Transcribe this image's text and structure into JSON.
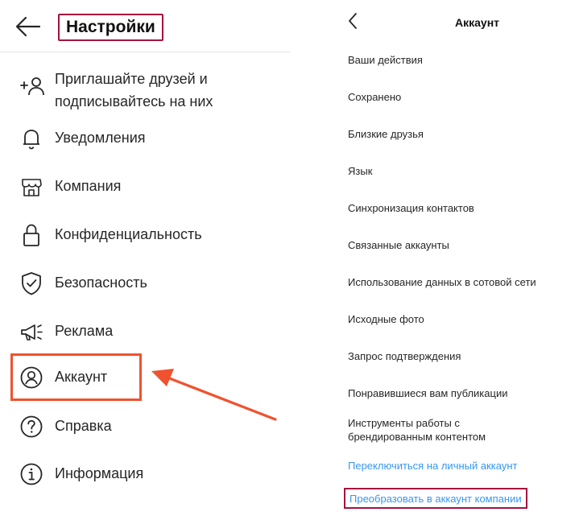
{
  "settings": {
    "title": "Настройки",
    "items": [
      {
        "label": "Приглашайте друзей и подписывайтесь на них",
        "icon": "add-person-icon"
      },
      {
        "label": "Уведомления",
        "icon": "bell-icon"
      },
      {
        "label": "Компания",
        "icon": "shop-icon"
      },
      {
        "label": "Конфиденциальность",
        "icon": "lock-icon"
      },
      {
        "label": "Безопасность",
        "icon": "shield-check-icon"
      },
      {
        "label": "Реклама",
        "icon": "megaphone-icon"
      },
      {
        "label": "Аккаунт",
        "icon": "user-circle-icon"
      },
      {
        "label": "Справка",
        "icon": "help-circle-icon"
      },
      {
        "label": "Информация",
        "icon": "info-circle-icon"
      }
    ],
    "highlighted_item": "Аккаунт"
  },
  "account": {
    "title": "Аккаунт",
    "items": [
      {
        "label": "Ваши действия"
      },
      {
        "label": "Сохранено"
      },
      {
        "label": "Близкие друзья"
      },
      {
        "label": "Язык"
      },
      {
        "label": "Синхронизация контактов"
      },
      {
        "label": "Связанные аккаунты"
      },
      {
        "label": "Использование данных в сотовой сети"
      },
      {
        "label": "Исходные фото"
      },
      {
        "label": "Запрос подтверждения"
      },
      {
        "label": "Понравившиеся вам публикации"
      },
      {
        "label": "Инструменты работы с брендированным контентом"
      }
    ],
    "switch_personal_link": "Переключиться на личный аккаунт",
    "convert_business_link": "Преобразовать в аккаунт компании"
  },
  "colors": {
    "highlight_orange": "#f0522f",
    "highlight_crimson": "#a4133c",
    "link_blue": "#3897f0",
    "text": "#262626"
  }
}
